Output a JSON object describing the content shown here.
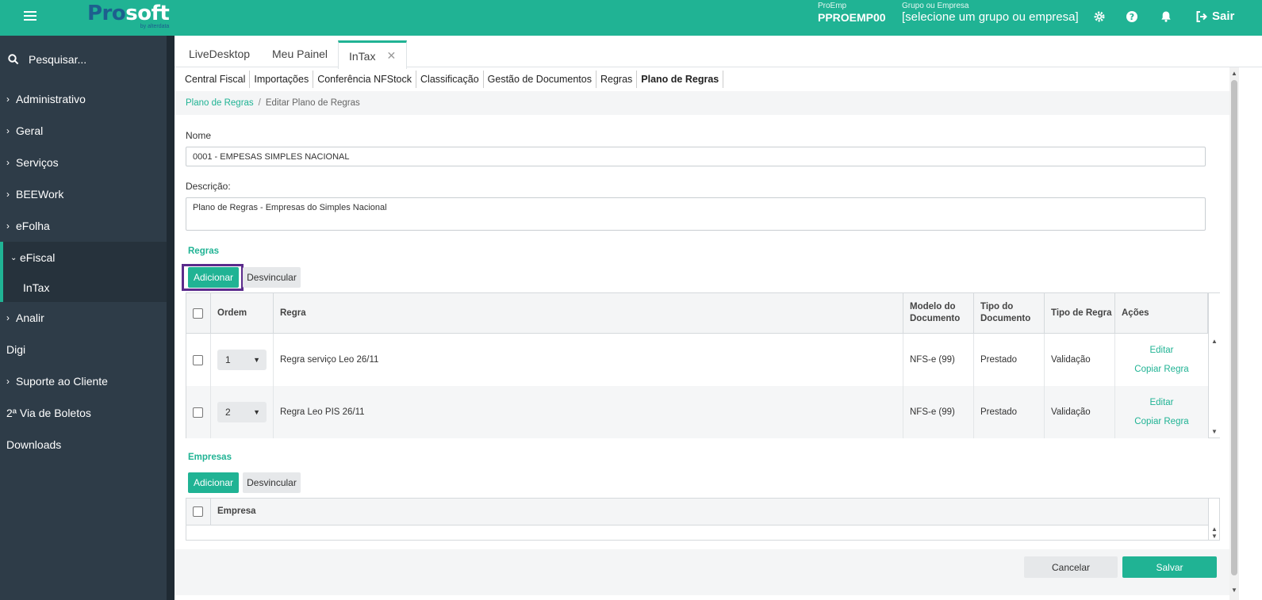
{
  "header": {
    "logo_pro": "Pro",
    "logo_soft": "soft",
    "logo_sub": "by alterdata",
    "proemp_label": "ProEmp",
    "proemp_value": "PPROEMP00",
    "grupo_label": "Grupo ou Empresa",
    "grupo_value": "[selecione um grupo ou empresa]",
    "sair_label": "Sair"
  },
  "sidebar": {
    "search_placeholder": "Pesquisar...",
    "items": [
      {
        "label": "Administrativo"
      },
      {
        "label": "Geral"
      },
      {
        "label": "Serviços"
      },
      {
        "label": "BEEWork"
      },
      {
        "label": "eFolha"
      },
      {
        "label": "eFiscal"
      },
      {
        "label": "InTax"
      },
      {
        "label": "Analir"
      },
      {
        "label": "Digi"
      },
      {
        "label": "Suporte ao Cliente"
      },
      {
        "label": "2ª Via de Boletos"
      },
      {
        "label": "Downloads"
      }
    ]
  },
  "tabs": [
    {
      "label": "LiveDesktop"
    },
    {
      "label": "Meu Painel"
    },
    {
      "label": "InTax"
    }
  ],
  "subtabs": [
    {
      "label": "Central Fiscal"
    },
    {
      "label": "Importações"
    },
    {
      "label": "Conferência NFStock"
    },
    {
      "label": "Classificação"
    },
    {
      "label": "Gestão de Documentos"
    },
    {
      "label": "Regras"
    },
    {
      "label": "Plano de Regras"
    }
  ],
  "breadcrumb": {
    "parent": "Plano de Regras",
    "separator": "/",
    "current": "Editar Plano de Regras"
  },
  "form": {
    "nome_label": "Nome",
    "nome_value": "0001 - EMPESAS SIMPLES NACIONAL",
    "descricao_label": "Descrição:",
    "descricao_value": "Plano de Regras - Empresas do Simples Nacional"
  },
  "regras": {
    "title": "Regras",
    "add_label": "Adicionar",
    "unlink_label": "Desvincular",
    "columns": {
      "ordem": "Ordem",
      "regra": "Regra",
      "modelo": "Modelo do Documento",
      "tipo_doc": "Tipo do Documento",
      "tipo_regra": "Tipo de Regra",
      "acoes": "Ações"
    },
    "rows": [
      {
        "ordem": "1",
        "regra": "Regra serviço Leo 26/11",
        "modelo": "NFS-e (99)",
        "tipo_doc": "Prestado",
        "tipo_regra": "Validação",
        "edit": "Editar",
        "copy": "Copiar Regra"
      },
      {
        "ordem": "2",
        "regra": "Regra Leo PIS 26/11",
        "modelo": "NFS-e (99)",
        "tipo_doc": "Prestado",
        "tipo_regra": "Validação",
        "edit": "Editar",
        "copy": "Copiar Regra"
      }
    ]
  },
  "empresas": {
    "title": "Empresas",
    "add_label": "Adicionar",
    "unlink_label": "Desvincular",
    "col_empresa": "Empresa"
  },
  "footer": {
    "cancel_label": "Cancelar",
    "save_label": "Salvar"
  },
  "colors": {
    "accent": "#20b394",
    "sidebar": "#2e3c48",
    "highlight": "#5b2b8c"
  }
}
